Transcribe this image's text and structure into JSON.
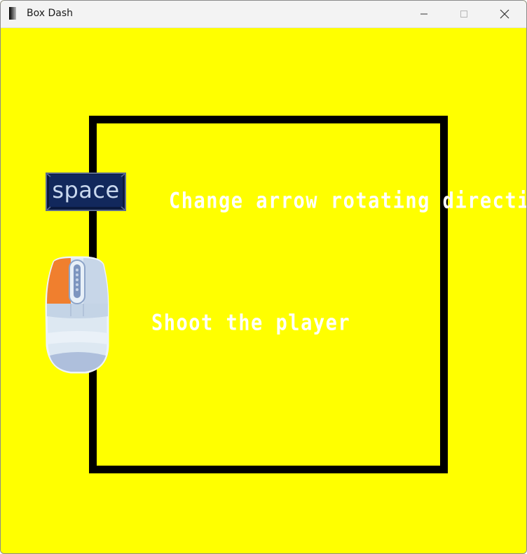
{
  "window": {
    "title": "Box Dash",
    "icons": {
      "app": "app-icon",
      "minimize": "minimize-icon",
      "maximize": "maximize-icon",
      "close": "close-icon"
    }
  },
  "colors": {
    "background": "#ffff00",
    "arena_border": "#000000",
    "hint_text": "#ffffff",
    "key_face": "#0e2252",
    "mouse_left_button": "#f07f2e"
  },
  "controls": {
    "space": {
      "key_label": "space",
      "description": "Change arrow rotating direction"
    },
    "mouse": {
      "icon": "mouse-left-click-icon",
      "description": "Shoot the player"
    }
  }
}
